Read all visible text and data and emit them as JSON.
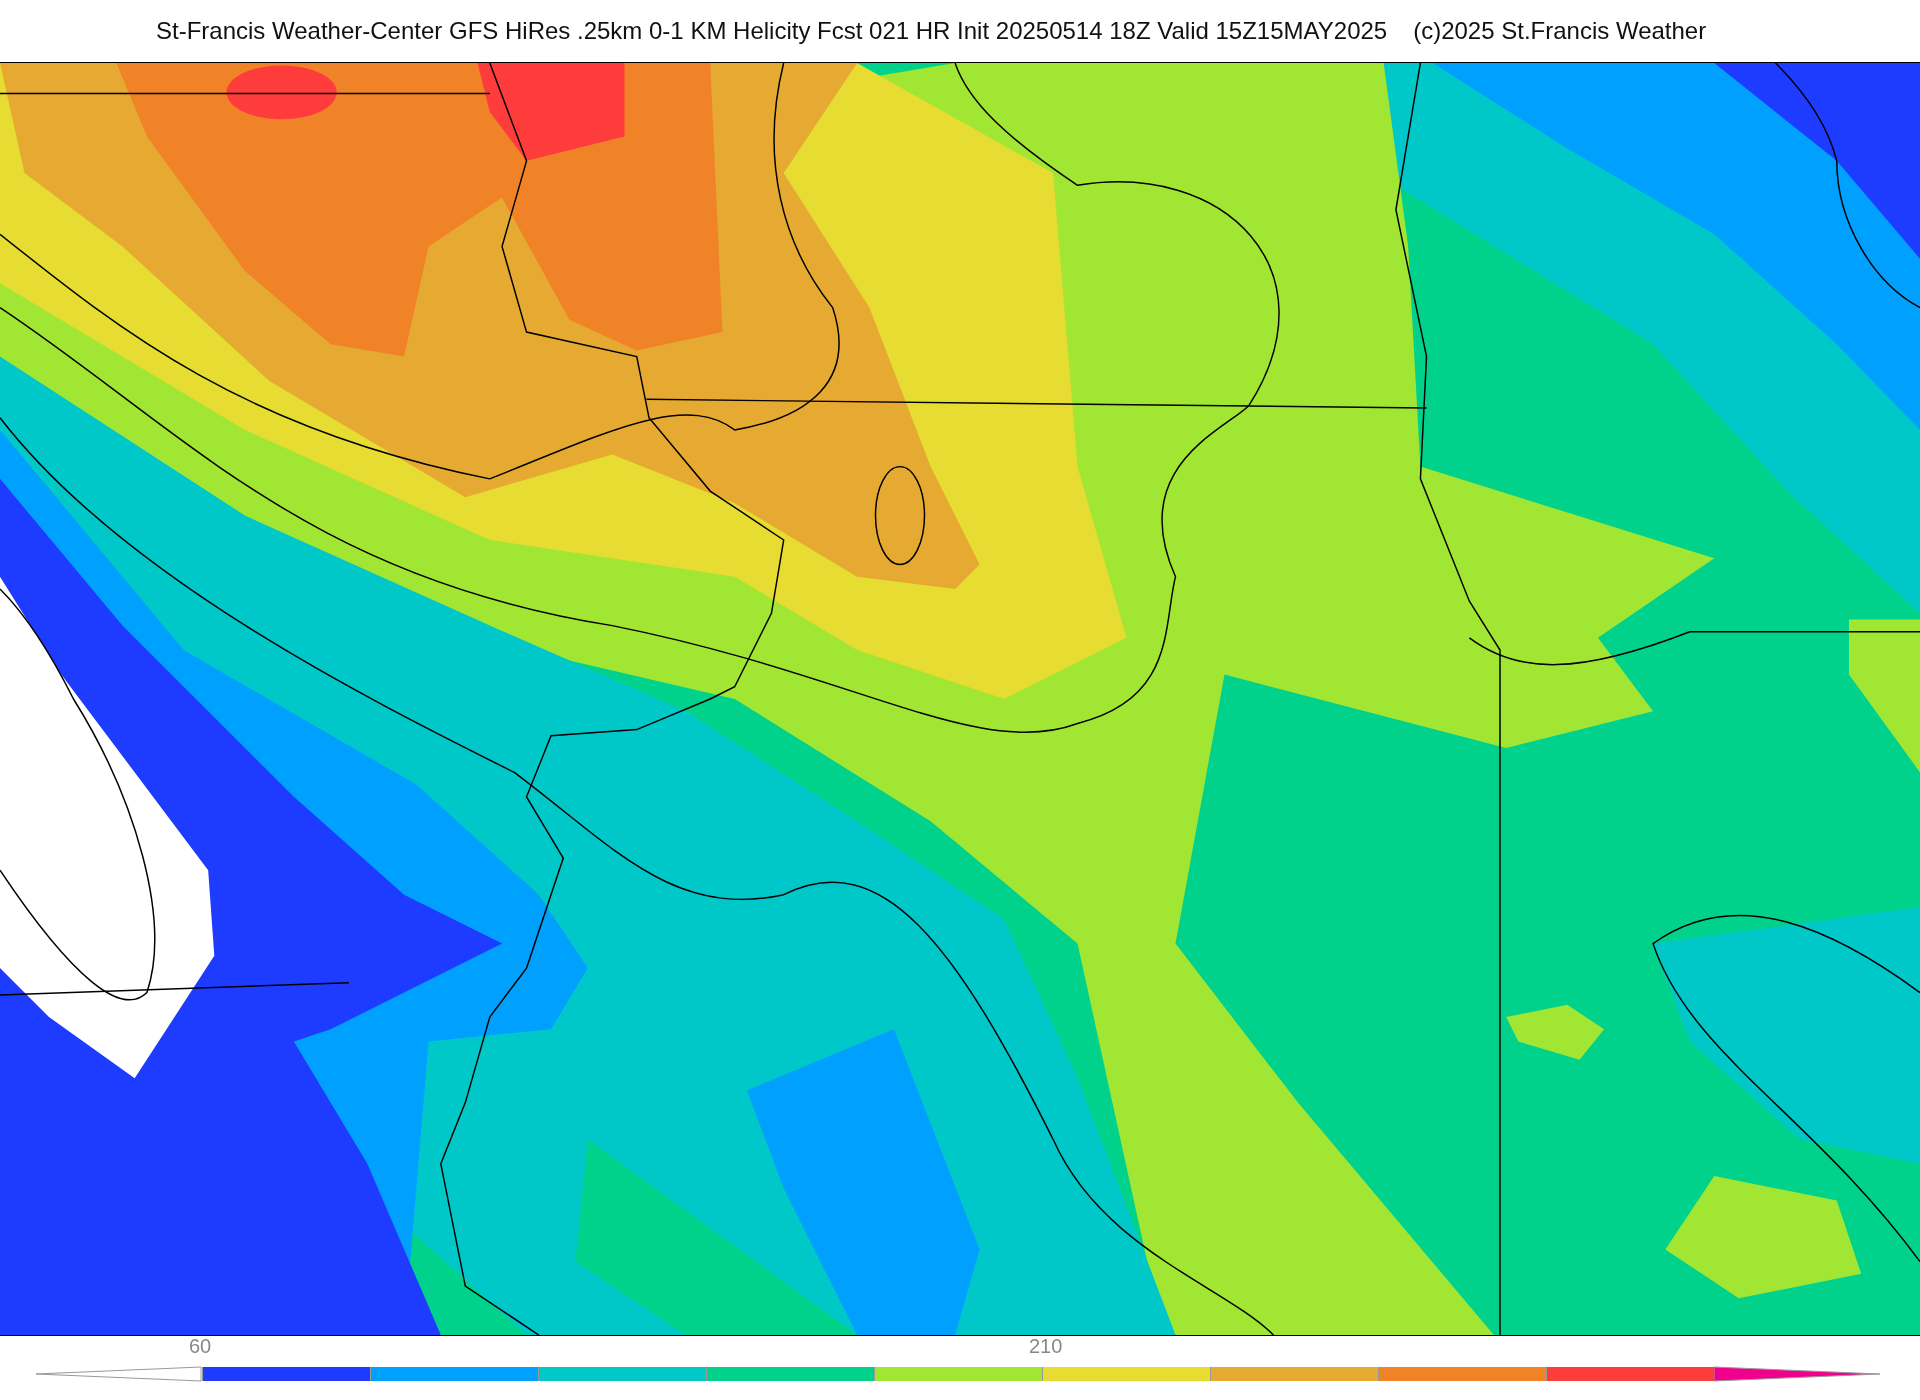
{
  "title": "St-Francis Weather-Center GFS HiRes .25km 0-1 KM Helicity Fcst 021 HR Init 20250514 18Z  Valid 15Z15MAY2025",
  "copyright": "(c)2025 St.Francis Weather",
  "colorbar": {
    "ends": [
      {
        "kind": "under",
        "color": "#ffffff"
      },
      {
        "kind": "over",
        "color": "#f0008c"
      }
    ],
    "segments": [
      {
        "color": "#1e3cff",
        "label": "60"
      },
      {
        "color": "#00a0ff"
      },
      {
        "color": "#00c8c8"
      },
      {
        "color": "#00d28c"
      },
      {
        "color": "#a0e632"
      },
      {
        "color": "#e6dc32",
        "label": "210"
      },
      {
        "color": "#e6aa32"
      },
      {
        "color": "#f08228"
      },
      {
        "color": "#ff3c3c"
      }
    ]
  }
}
